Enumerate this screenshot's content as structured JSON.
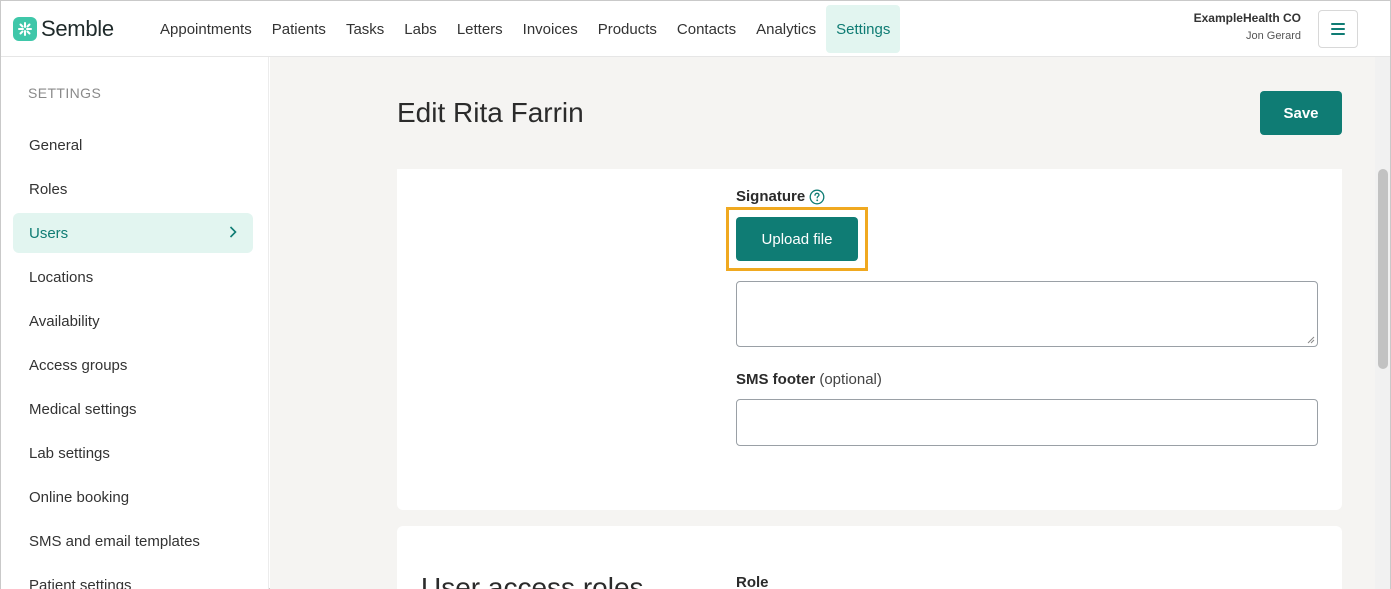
{
  "brand": {
    "name": "Semble",
    "icon": "semble-logo-icon",
    "accent": "#0f7c74",
    "accent_light": "#e2f5f0",
    "logo_color": "#3fc7a9"
  },
  "nav": {
    "items": [
      {
        "label": "Appointments",
        "active": false
      },
      {
        "label": "Patients",
        "active": false
      },
      {
        "label": "Tasks",
        "active": false
      },
      {
        "label": "Labs",
        "active": false
      },
      {
        "label": "Letters",
        "active": false
      },
      {
        "label": "Invoices",
        "active": false
      },
      {
        "label": "Products",
        "active": false
      },
      {
        "label": "Contacts",
        "active": false
      },
      {
        "label": "Analytics",
        "active": false
      },
      {
        "label": "Settings",
        "active": true
      }
    ],
    "org_name": "ExampleHealth CO",
    "user_name": "Jon Gerard",
    "menu_icon": "hamburger-menu-icon"
  },
  "sidebar": {
    "heading": "SETTINGS",
    "items": [
      {
        "label": "General"
      },
      {
        "label": "Roles"
      },
      {
        "label": "Users",
        "active": true
      },
      {
        "label": "Locations"
      },
      {
        "label": "Availability"
      },
      {
        "label": "Access groups"
      },
      {
        "label": "Medical settings"
      },
      {
        "label": "Lab settings"
      },
      {
        "label": "Online booking"
      },
      {
        "label": "SMS and email templates"
      },
      {
        "label": "Patient settings"
      }
    ]
  },
  "main": {
    "title": "Edit Rita Farrin",
    "save_label": "Save",
    "signature": {
      "label": "Signature",
      "help_icon": "question-circle-icon",
      "upload_label": "Upload file",
      "highlight_color": "#f0a920",
      "text_value": ""
    },
    "sms_footer": {
      "label": "SMS footer",
      "optional": "(optional)",
      "value": ""
    },
    "access": {
      "title": "User access roles",
      "role_label": "Role"
    }
  }
}
